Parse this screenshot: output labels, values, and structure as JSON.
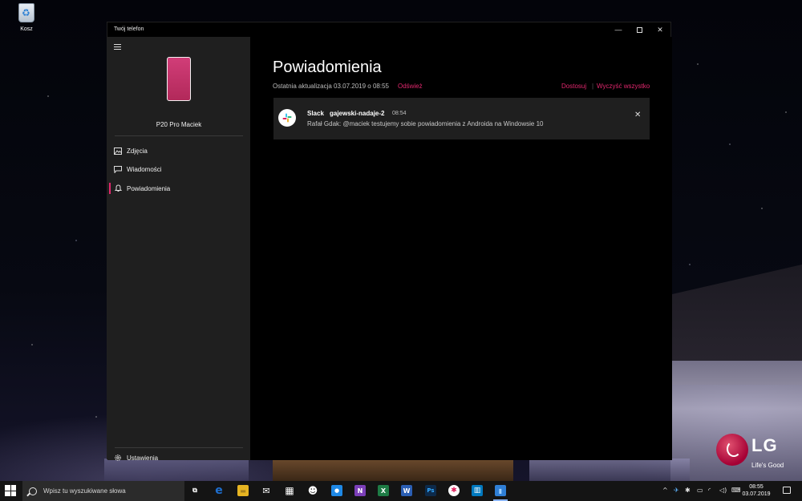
{
  "desktop": {
    "recycle_bin_label": "Kosz",
    "lg_logo_text": "LG",
    "lg_tagline": "Life's Good"
  },
  "window": {
    "title": "Twój telefon",
    "controls": {
      "minimize": "—",
      "close": "✕"
    }
  },
  "sidebar": {
    "device_name": "P20 Pro Maciek",
    "items": [
      {
        "label": "Zdjęcia",
        "icon": "photos-icon",
        "active": false
      },
      {
        "label": "Wiadomości",
        "icon": "messages-icon",
        "active": false
      },
      {
        "label": "Powiadomienia",
        "icon": "bell-icon",
        "active": true
      }
    ],
    "settings_label": "Ustawienia"
  },
  "main": {
    "heading": "Powiadomienia",
    "last_updated": "Ostatnia aktualizacja 03.07.2019 o 08:55",
    "refresh_label": "Odśwież",
    "customize_label": "Dostosuj",
    "separator": "|",
    "clear_all_label": "Wyczyść wszystko",
    "notifications": [
      {
        "app": "Slack",
        "channel": "gajewski-nadaje-2",
        "time": "08:54",
        "body": "Rafał Gdak: @maciek testujemy sobie powiadomienia z Androida na Windowsie 10",
        "close": "✕"
      }
    ]
  },
  "taskbar": {
    "search_placeholder": "Wpisz tu wyszukiwane słowa",
    "clock_time": "08:55",
    "clock_date": "03.07.2019",
    "icons": [
      {
        "name": "task-view-icon",
        "glyph": "⧉",
        "color": "#141414"
      },
      {
        "name": "edge-icon",
        "glyph": "e",
        "color": "#1e6fd0"
      },
      {
        "name": "file-explorer-icon",
        "glyph": "▬",
        "color": "#e6b422"
      },
      {
        "name": "mail-icon",
        "glyph": "✉",
        "color": "#141414"
      },
      {
        "name": "calendar-icon",
        "glyph": "▦",
        "color": "#141414"
      },
      {
        "name": "people-icon",
        "glyph": "☻",
        "color": "#141414"
      },
      {
        "name": "messenger-icon",
        "glyph": "●",
        "color": "#1e88e5"
      },
      {
        "name": "onenote-icon",
        "glyph": "N",
        "color": "#7b3fb8"
      },
      {
        "name": "excel-icon",
        "glyph": "X",
        "color": "#1e7b45"
      },
      {
        "name": "word-icon",
        "glyph": "W",
        "color": "#2b5fb4"
      },
      {
        "name": "photoshop-icon",
        "glyph": "Ps",
        "color": "#0d2a4a"
      },
      {
        "name": "slack-icon",
        "glyph": "✱",
        "color": "#141414"
      },
      {
        "name": "trello-icon",
        "glyph": "▥",
        "color": "#0079bf"
      },
      {
        "name": "your-phone-icon",
        "glyph": "▮",
        "color": "#2f7fd6"
      }
    ],
    "tray": [
      "^",
      "✈",
      "✱",
      "▭",
      "◜",
      "◁)",
      "⌨"
    ]
  }
}
